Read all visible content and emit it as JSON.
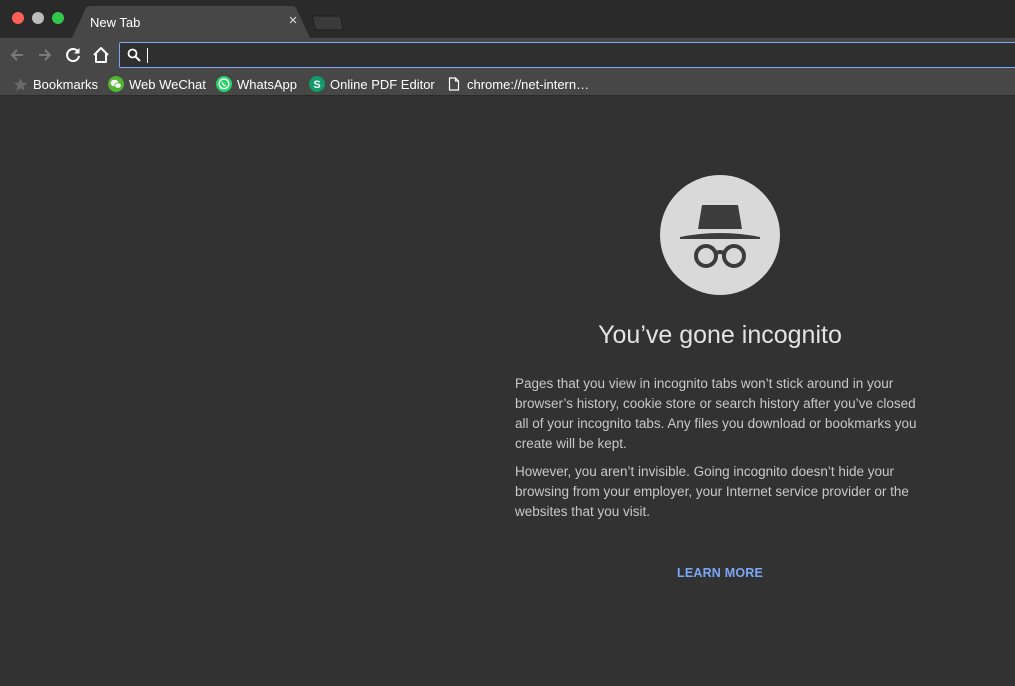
{
  "tab": {
    "title": "New Tab",
    "close_glyph": "×"
  },
  "omnibox": {
    "value": "",
    "placeholder": ""
  },
  "bookmarks": [
    {
      "label": "Bookmarks",
      "icon": "star-icon"
    },
    {
      "label": "Web WeChat",
      "icon": "wechat-icon"
    },
    {
      "label": "WhatsApp",
      "icon": "whatsapp-icon"
    },
    {
      "label": "Online PDF Editor",
      "icon": "pdf-editor-s-icon"
    },
    {
      "label": "chrome://net-intern…",
      "icon": "page-icon"
    }
  ],
  "content": {
    "headline": "You’ve gone incognito",
    "paragraph1": "Pages that you view in incognito tabs won’t stick around in your browser’s history, cookie store or search history after you’ve closed all of your incognito tabs. Any files you download or bookmarks you create will be kept.",
    "paragraph2": "However, you aren’t invisible. Going incognito doesn’t hide your browsing from your employer, your Internet service provider or the websites that you visit.",
    "learn_more": "LEARN MORE"
  },
  "colors": {
    "page_bg": "#323232",
    "toolbar_bg": "#474747",
    "tab_bg": "#474747",
    "omnibox_focus": "#7ea6f5",
    "link": "#7ba7f6",
    "wechat_green": "#50b631",
    "whatsapp_green": "#25d366",
    "pdf_editor_green": "#129a6a",
    "icon_circle": "#d9d9d9"
  }
}
